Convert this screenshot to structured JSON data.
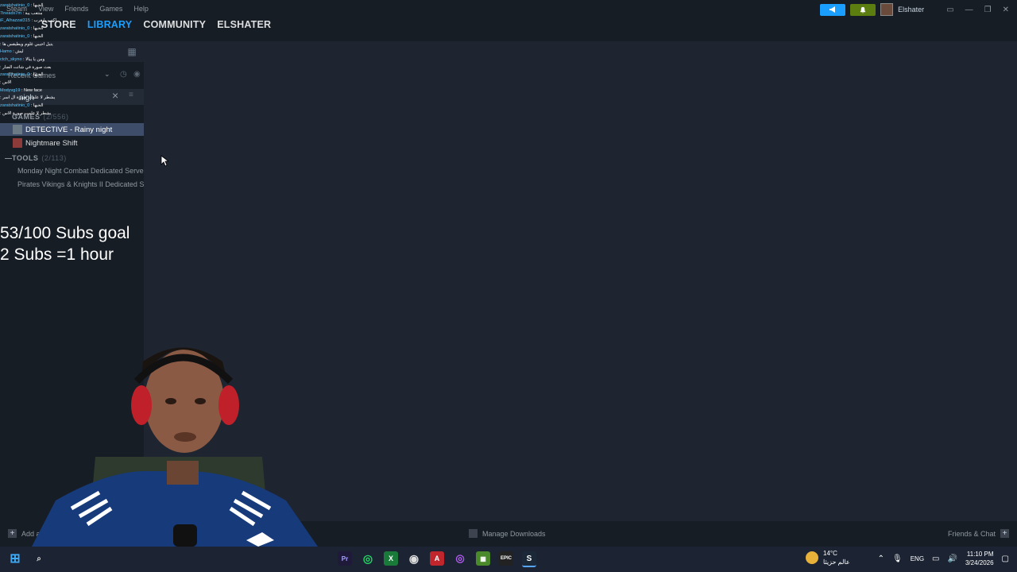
{
  "menu": {
    "items": [
      "Steam",
      "View",
      "Friends",
      "Games",
      "Help"
    ]
  },
  "nav": {
    "tabs": [
      {
        "label": "STORE",
        "active": false
      },
      {
        "label": "LIBRARY",
        "active": true
      },
      {
        "label": "COMMUNITY",
        "active": false
      },
      {
        "label": "ELSHATER",
        "active": false
      }
    ]
  },
  "account": {
    "username": "Elshater"
  },
  "library": {
    "filter_label": "Recent Games",
    "search": {
      "value": "nigh",
      "placeholder": ""
    },
    "games_header": {
      "label": "GAMES",
      "count": "(2/556)"
    },
    "games": [
      {
        "name": "DETECTIVE - Rainy night",
        "selected": true
      },
      {
        "name": "Nightmare Shift",
        "selected": false
      }
    ],
    "tools_header": {
      "label": "TOOLS",
      "count": "(2/113)"
    },
    "tools": [
      {
        "name": "Monday Night Combat Dedicated Server"
      },
      {
        "name": "Pirates Vikings & Knights II Dedicated Server"
      }
    ]
  },
  "overlay": {
    "line1": "53/100 Subs goal",
    "line2": "2 Subs =1 hour"
  },
  "chat": [
    {
      "user": "zaratshatinio_0",
      "msg": "الحبها"
    },
    {
      "user": "7ineadx7m",
      "msg": "منتعب يبة"
    },
    {
      "user": "iF_Alhazzat315",
      "msg": "اكتب يايقرب"
    },
    {
      "user": "zaratshatinio_0",
      "msg": "الحبها"
    },
    {
      "user": "zaratshatinio_0",
      "msg": "الحبها"
    },
    {
      "user": "",
      "msg": "يتيل اجيبي غلوم ويطيقس ها"
    },
    {
      "user": "Hamo",
      "msg": "ليش"
    },
    {
      "user": "ctch_skyno",
      "msg": "ومن يا يبالا"
    },
    {
      "user": "",
      "msg": "بعث صورة في شاتت الضار"
    },
    {
      "user": "zaratshatinio_0",
      "msg": "الحبها"
    },
    {
      "user": "",
      "msg": "الاس"
    },
    {
      "user": "Modyvg19",
      "msg": "New face"
    },
    {
      "user": "",
      "msg": "يشطر لا علمت صورة ال اسر"
    },
    {
      "user": "zaratshatinio_0",
      "msg": "الحبها"
    },
    {
      "user": "",
      "msg": "يشطر لا علمت صورة الاس"
    }
  ],
  "bottombar": {
    "add_game": "Add a Game",
    "downloads": "Manage Downloads",
    "friends": "Friends & Chat"
  },
  "taskbar": {
    "weather_temp": "14°C",
    "weather_desc": "عالم حزيثا",
    "lang": "ENG",
    "time": "11:10 PM",
    "date": "3/24/2026"
  },
  "colors": {
    "accent": "#1a9fff",
    "green": "#5c7e10",
    "bg": "#1e2430",
    "sidebar": "#171d25"
  }
}
